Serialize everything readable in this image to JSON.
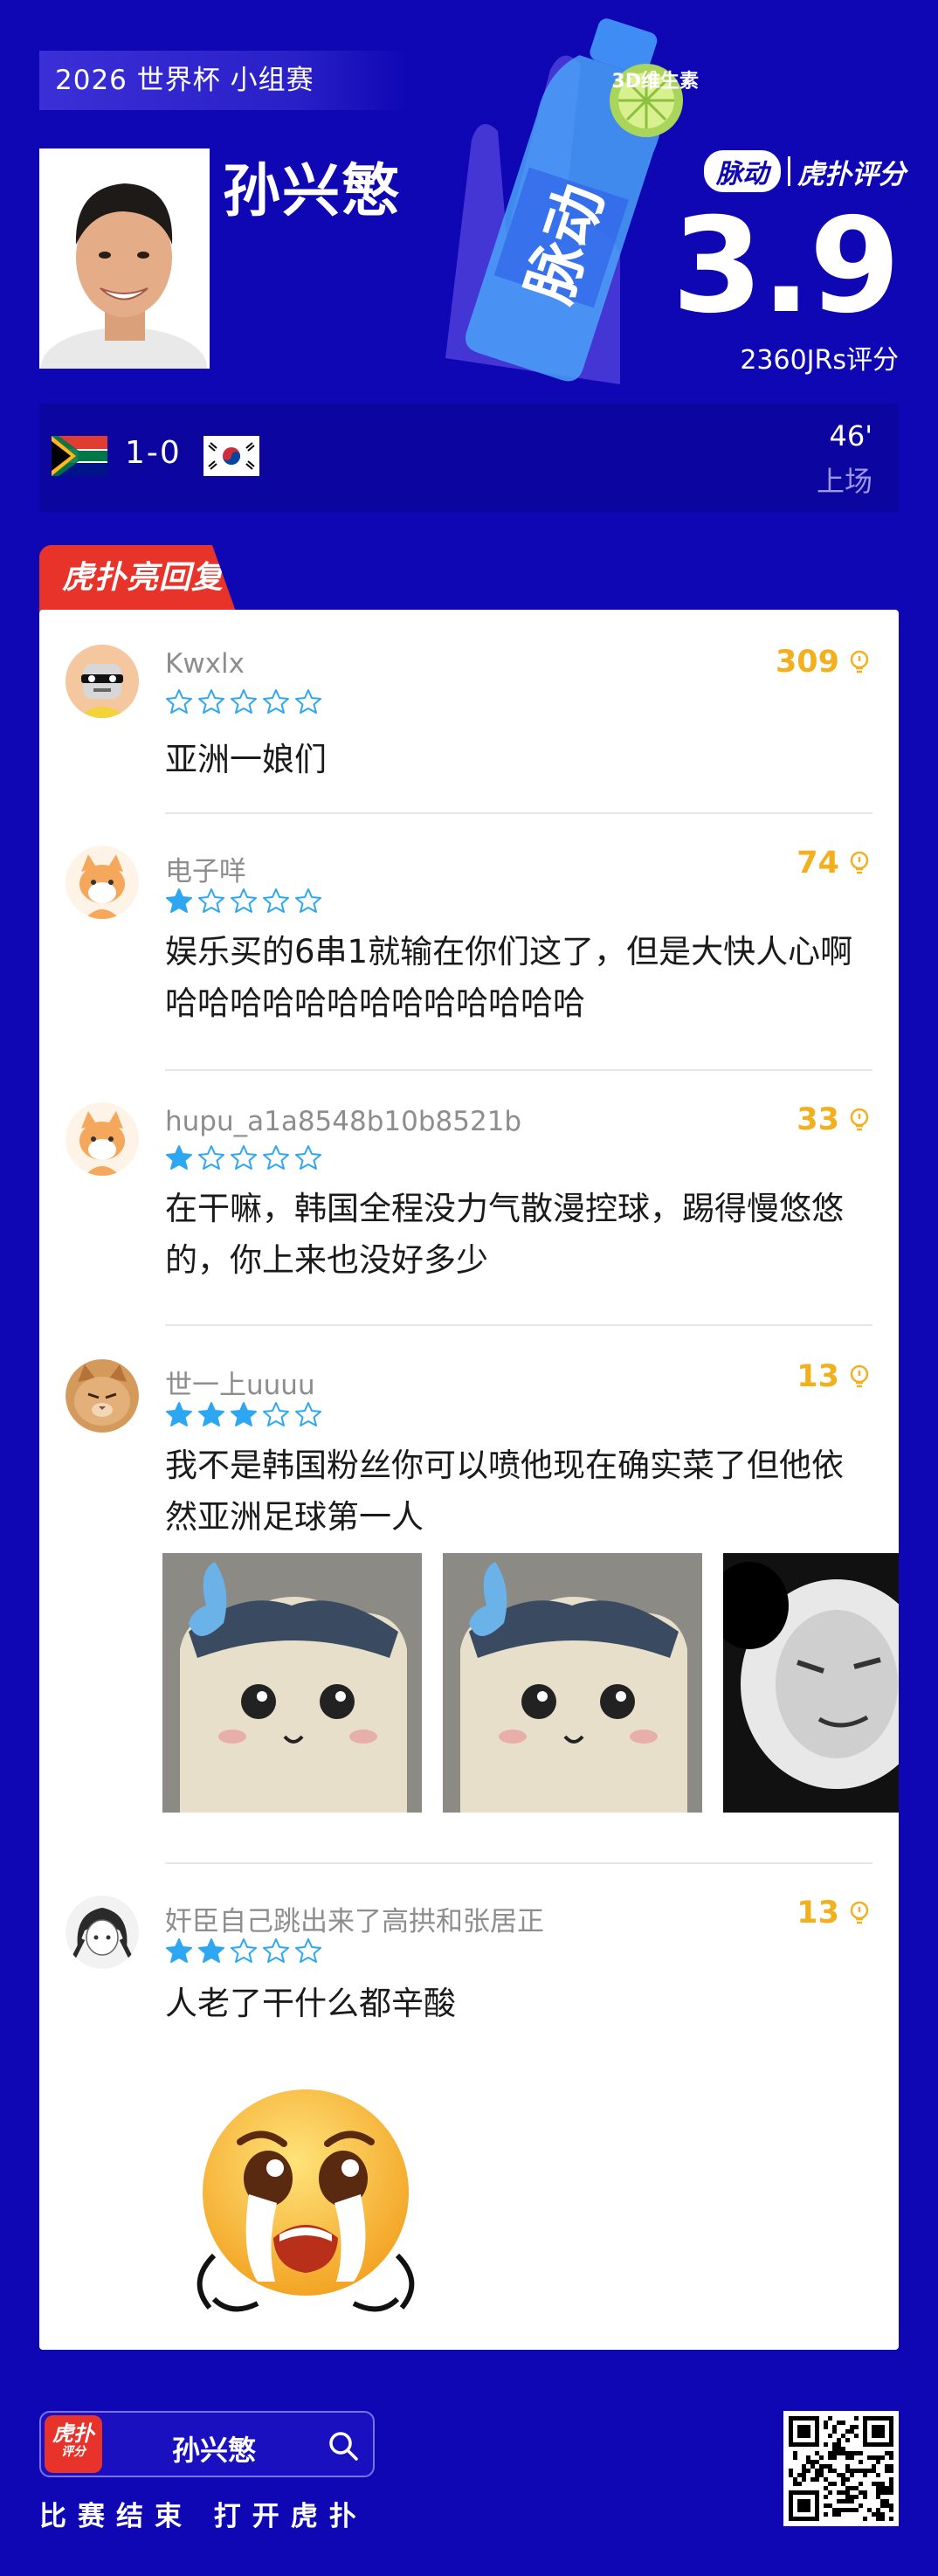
{
  "header": {
    "tag": "2026 世界杯 小组赛",
    "player_name": "孙兴慜",
    "brand_sponsor": "脉动",
    "brand_rating": "虎扑评分",
    "score": "3.9",
    "rating_count": "2360JRs评分",
    "bottle_text": "脉动",
    "bottle_label": "3D维生素"
  },
  "match": {
    "score": "1-0",
    "minute": "46'",
    "status": "上场",
    "home_flag": "south-africa-flag",
    "away_flag": "south-korea-flag"
  },
  "section_badge": "虎扑亮回复",
  "comments": [
    {
      "user": "Kwxlx",
      "likes": "309",
      "stars": 0,
      "text": "亚洲一娘们",
      "avatar": "robot-avatar"
    },
    {
      "user": "电子咩",
      "likes": "74",
      "stars": 1,
      "text": "娱乐买的6串1就输在你们这了，但是大快人心啊哈哈哈哈哈哈哈哈哈哈哈哈哈",
      "avatar": "fox-avatar"
    },
    {
      "user": "hupu_a1a8548b10b8521b",
      "likes": "33",
      "stars": 1,
      "text": "在干嘛，韩国全程没力气散漫控球，踢得慢悠悠的，你上来也没好多少",
      "avatar": "fox-avatar"
    },
    {
      "user": "世一上uuuu",
      "likes": "13",
      "stars": 3,
      "text": "我不是韩国粉丝你可以喷他现在确实菜了但他依然亚洲足球第一人",
      "avatar": "cat-avatar"
    },
    {
      "user": "奸臣自己跳出来了高拱和张居正",
      "likes": "13",
      "stars": 2,
      "text": "人老了干什么都辛酸",
      "avatar": "anime-avatar"
    }
  ],
  "footer": {
    "search_logo": "虎扑",
    "search_logo_sub": "评分",
    "search_name": "孙兴慜",
    "tagline": "比赛结束 打开虎扑"
  },
  "colors": {
    "background": "#1007b4",
    "accent_red": "#e8332a",
    "like_gold": "#f2b01e",
    "star_blue": "#2ea7f2"
  }
}
